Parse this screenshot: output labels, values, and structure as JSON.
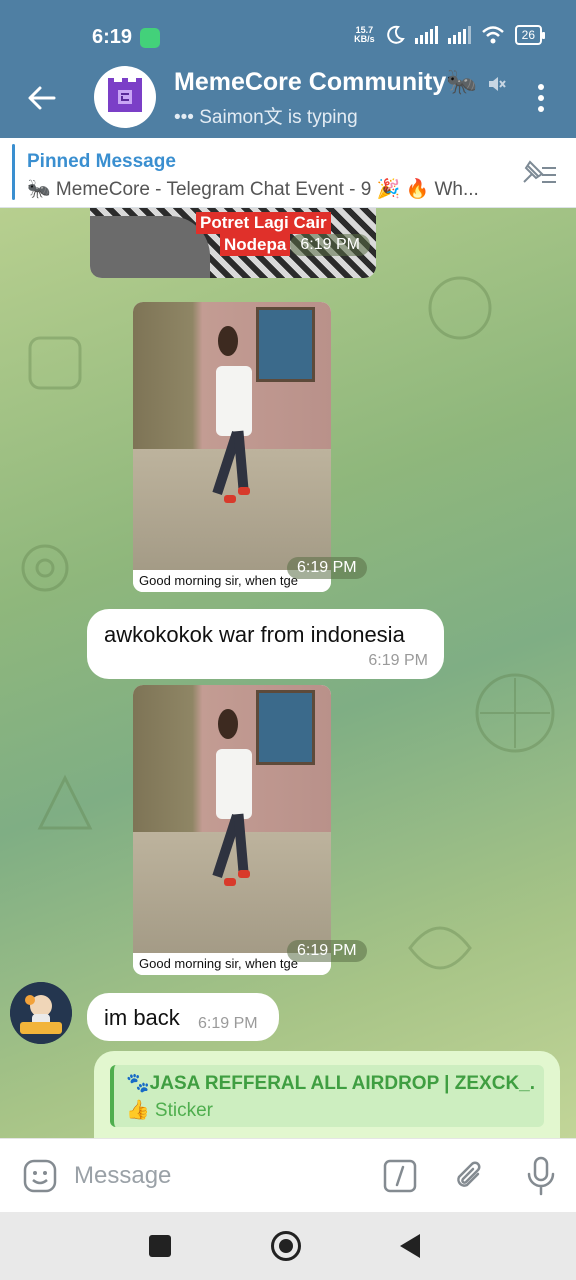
{
  "status_bar": {
    "time": "6:19",
    "net_speed_value": "15.7",
    "net_speed_unit": "KB/s",
    "battery": "26",
    "icons": [
      "app-notification-icon",
      "moon-icon",
      "signal-icon",
      "signal-icon",
      "wifi-icon",
      "battery-icon"
    ]
  },
  "header": {
    "title": "MemeCore Community🐜",
    "subtitle": "••• Saimon文 is typing",
    "icons": [
      "back-arrow-icon",
      "mute-icon",
      "more-vertical-icon"
    ]
  },
  "pinned": {
    "title": "Pinned Message",
    "text": "🐜 MemeCore - Telegram Chat Event - 9 🎉 🔥 Wh..."
  },
  "messages": {
    "m1": {
      "overlay_line1": "Potret Lagi Cair",
      "overlay_line2": "Nodepa",
      "time": "6:19 PM"
    },
    "m2": {
      "caption": "Good morning sir, when tge",
      "time": "6:19 PM"
    },
    "m3": {
      "text": "awkokokok war from indonesia",
      "time": "6:19 PM"
    },
    "m4": {
      "caption": "Good morning sir, when tge",
      "time": "6:19 PM"
    },
    "m5": {
      "text": "im back",
      "time": "6:19 PM"
    },
    "m6": {
      "reply_title": "🐾JASA REFFERAL ALL AIRDROP | ZEXCK_...",
      "reply_sub": "👍 Sticker"
    }
  },
  "input": {
    "placeholder": "Message",
    "icons": [
      "emoji-icon",
      "bot-command-icon",
      "attach-icon",
      "microphone-icon"
    ]
  },
  "nav": {
    "icons": [
      "recents-square-icon",
      "home-circle-icon",
      "back-triangle-icon"
    ]
  },
  "colors": {
    "header": "#4f7fa3",
    "pinned_accent": "#3a8fd0",
    "outgoing_bubble": "#e2f7cf",
    "reply_accent": "#4fae4e"
  }
}
